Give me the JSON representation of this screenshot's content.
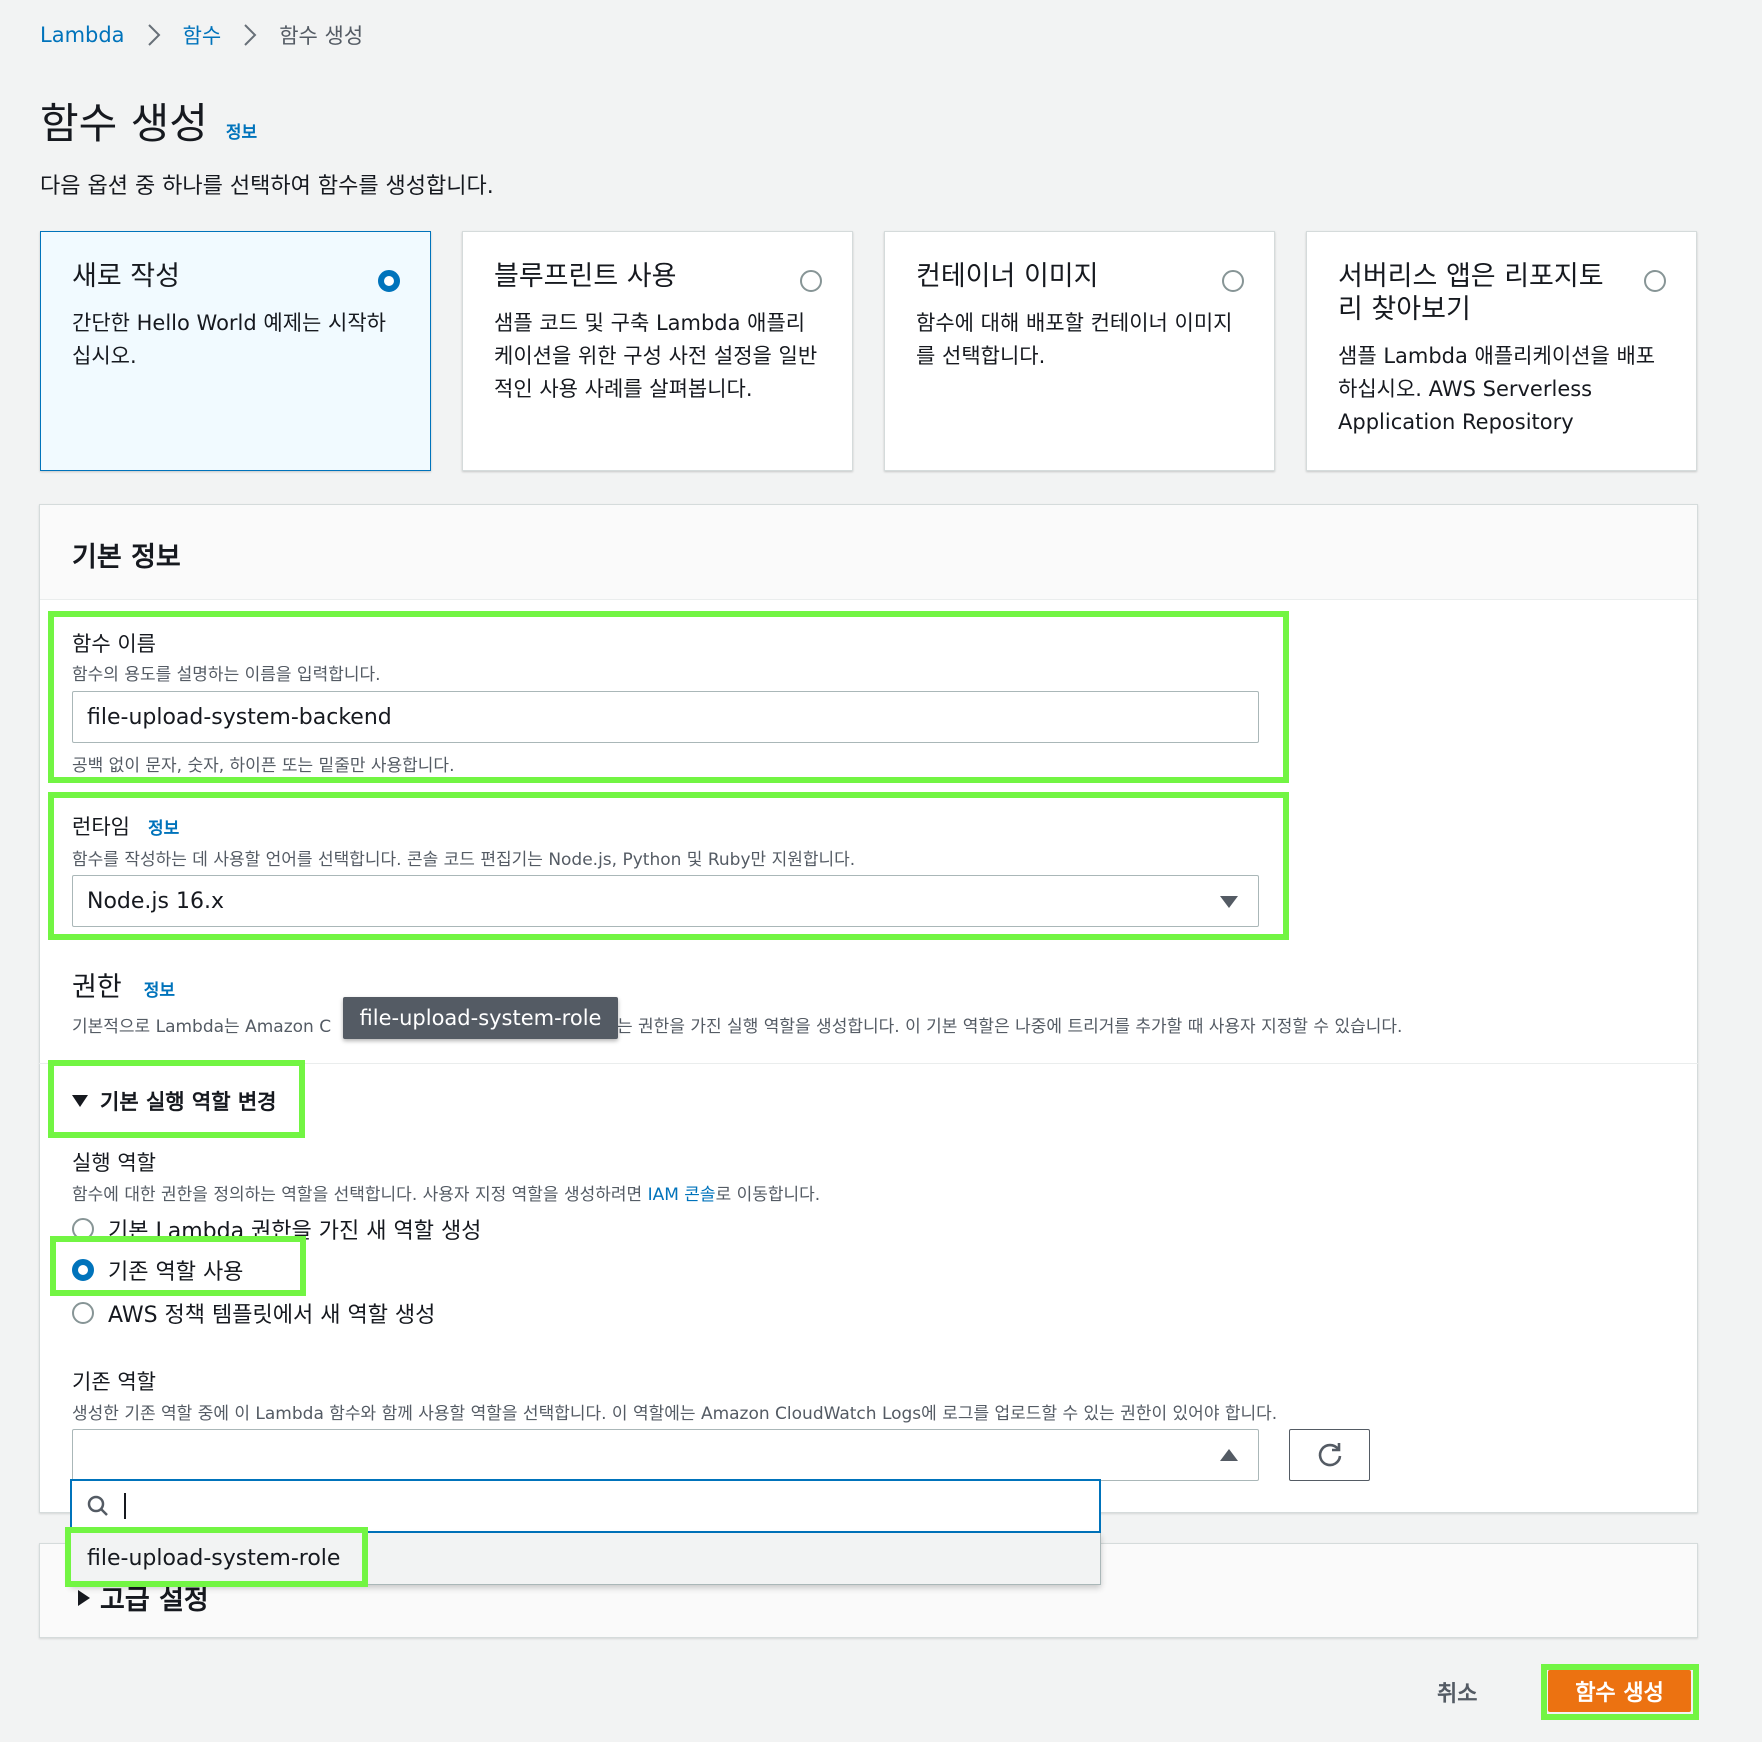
{
  "breadcrumb": {
    "root": "Lambda",
    "functions": "함수",
    "current": "함수 생성"
  },
  "page": {
    "title": "함수 생성",
    "info_link": "정보",
    "description": "다음 옵션 중 하나를 선택하여 함수를 생성합니다."
  },
  "options": [
    {
      "title": "새로 작성",
      "desc": "간단한 Hello World 예제는 시작하십시오.",
      "selected": true
    },
    {
      "title": "블루프린트 사용",
      "desc": "샘플 코드 및 구축 Lambda 애플리케이션을 위한 구성 사전 설정을 일반적인 사용 사례를 살펴봅니다.",
      "selected": false
    },
    {
      "title": "컨테이너 이미지",
      "desc": "함수에 대해 배포할 컨테이너 이미지를 선택합니다.",
      "selected": false
    },
    {
      "title": "서버리스 앱은 리포지토리 찾아보기",
      "desc": "샘플 Lambda 애플리케이션을 배포하십시오. AWS Serverless Application Repository",
      "selected": false
    }
  ],
  "basic_info": {
    "title": "기본 정보",
    "function_name": {
      "label": "함수 이름",
      "hint": "함수의 용도를 설명하는 이름을 입력합니다.",
      "value": "file-upload-system-backend",
      "constraint": "공백 없이 문자, 숫자, 하이픈 또는 밑줄만 사용합니다."
    },
    "runtime": {
      "label": "런타임",
      "info_link": "정보",
      "hint": "함수를 작성하는 데 사용할 언어를 선택합니다. 콘솔 코드 편집기는 Node.js, Python 및 Ruby만 지원합니다.",
      "value": "Node.js 16.x"
    },
    "permissions": {
      "label": "권한",
      "info_link": "정보",
      "desc_before": "기본적으로 Lambda는 Amazon C",
      "desc_after": "는 권한을 가진 실행 역할을 생성합니다. 이 기본 역할은 나중에 트리거를 추가할 때 사용자 지정할 수 있습니다.",
      "tooltip": "file-upload-system-role"
    },
    "change_role": {
      "toggle_label": "기본 실행 역할 변경",
      "exec_role_label": "실행 역할",
      "exec_role_hint_before": "함수에 대한 권한을 정의하는 역할을 선택합니다. 사용자 지정 역할을 생성하려면 ",
      "exec_role_hint_link": "IAM 콘솔",
      "exec_role_hint_after": "로 이동합니다.",
      "radio_options": [
        {
          "label": "기본 Lambda 권한을 가진 새 역할 생성",
          "checked": false
        },
        {
          "label": "기존 역할 사용",
          "checked": true
        },
        {
          "label": "AWS 정책 템플릿에서 새 역할 생성",
          "checked": false
        }
      ],
      "existing_role_label": "기존 역할",
      "existing_role_hint": "생성한 기존 역할 중에 이 Lambda 함수와 함께 사용할 역할을 선택합니다. 이 역할에는 Amazon CloudWatch Logs에 로그를 업로드할 수 있는 권한이 있어야 합니다.",
      "existing_role_value": "",
      "search_value": "",
      "dropdown_options": [
        "file-upload-system-role"
      ]
    }
  },
  "advanced": {
    "label": "고급 설정"
  },
  "footer": {
    "cancel": "취소",
    "create": "함수 생성"
  },
  "colors": {
    "accent": "#0073bb",
    "primary_button": "#ec7211",
    "highlight": "#72f543"
  }
}
